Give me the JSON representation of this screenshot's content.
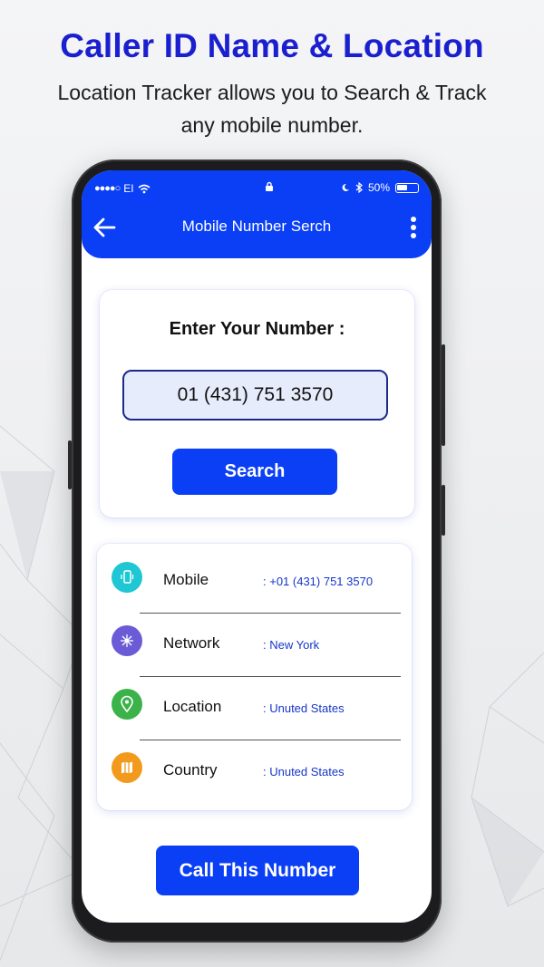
{
  "promo": {
    "headline": "Caller ID Name & Location",
    "subline_1": "Location Tracker allows you to Search & Track",
    "subline_2": "any mobile number."
  },
  "status_bar": {
    "carrier": "EI",
    "battery": "50%"
  },
  "toolbar": {
    "title": "Mobile Number Serch",
    "back_icon": "arrow-left-icon",
    "menu_icon": "more-vertical-icon"
  },
  "search_card": {
    "label": "Enter Your Number :",
    "number_value": "01 (431) 751 3570",
    "search_button": "Search"
  },
  "info": {
    "rows": [
      {
        "label": "Mobile",
        "value": ": +01 (431) 751 3570",
        "icon": "phone-vibrate-icon",
        "color": "#1fc7d4"
      },
      {
        "label": "Network",
        "value": ": New York",
        "icon": "network-icon",
        "color": "#6b5bd6"
      },
      {
        "label": "Location",
        "value": ": Unuted States",
        "icon": "location-pin-icon",
        "color": "#3cb34a"
      },
      {
        "label": "Country",
        "value": ": Unuted States",
        "icon": "map-icon",
        "color": "#f29a1d"
      }
    ]
  },
  "call_button": "Call This Number",
  "colors": {
    "brand_blue": "#0a3ff5",
    "headline_blue": "#1a1fcf"
  }
}
